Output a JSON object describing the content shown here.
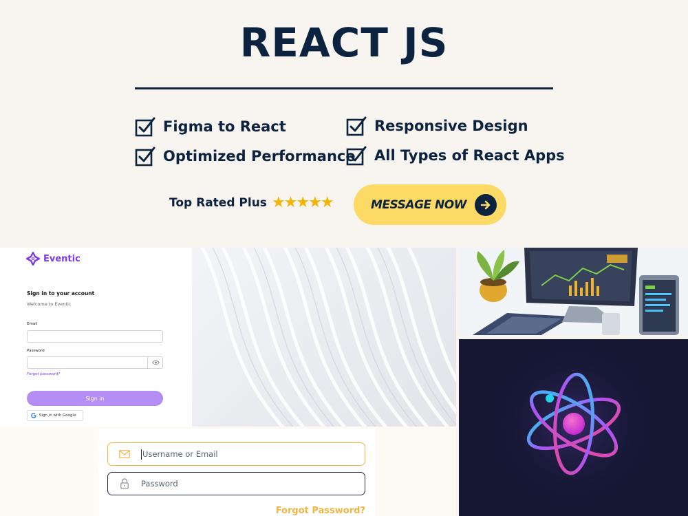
{
  "header": {
    "title": "REACT JS",
    "features": [
      {
        "label": "Figma to React"
      },
      {
        "label": "Responsive Design"
      },
      {
        "label": "Optimized Performance"
      },
      {
        "label": "All Types of React Apps"
      }
    ],
    "rating_label": "Top Rated Plus",
    "stars": "★★★★★",
    "cta_label": "MESSAGE NOW"
  },
  "eventic": {
    "brand": "Eventic",
    "heading": "Sign in to your account",
    "subheading": "Welcome to Eventic",
    "email_label": "Email",
    "password_label": "Password",
    "forgot_link": "Forgot password?",
    "signin_button": "Sign in",
    "google_button": "Sign in with Google"
  },
  "login": {
    "username_placeholder": "Username or Email",
    "password_placeholder": "Password",
    "forgot_link": "Forgot Password?"
  },
  "colors": {
    "navy": "#0c2340",
    "cta_yellow": "#fdd965",
    "star_gold": "#f4b400",
    "eventic_purple": "#7c3aed",
    "login_accent": "#f2b544",
    "atom_background": "#151733"
  },
  "icons": [
    "checkbox-check-icon",
    "arrow-right-icon",
    "eventic-logo-icon",
    "eye-icon",
    "google-icon",
    "mail-icon",
    "lock-icon",
    "react-atom-icon"
  ]
}
